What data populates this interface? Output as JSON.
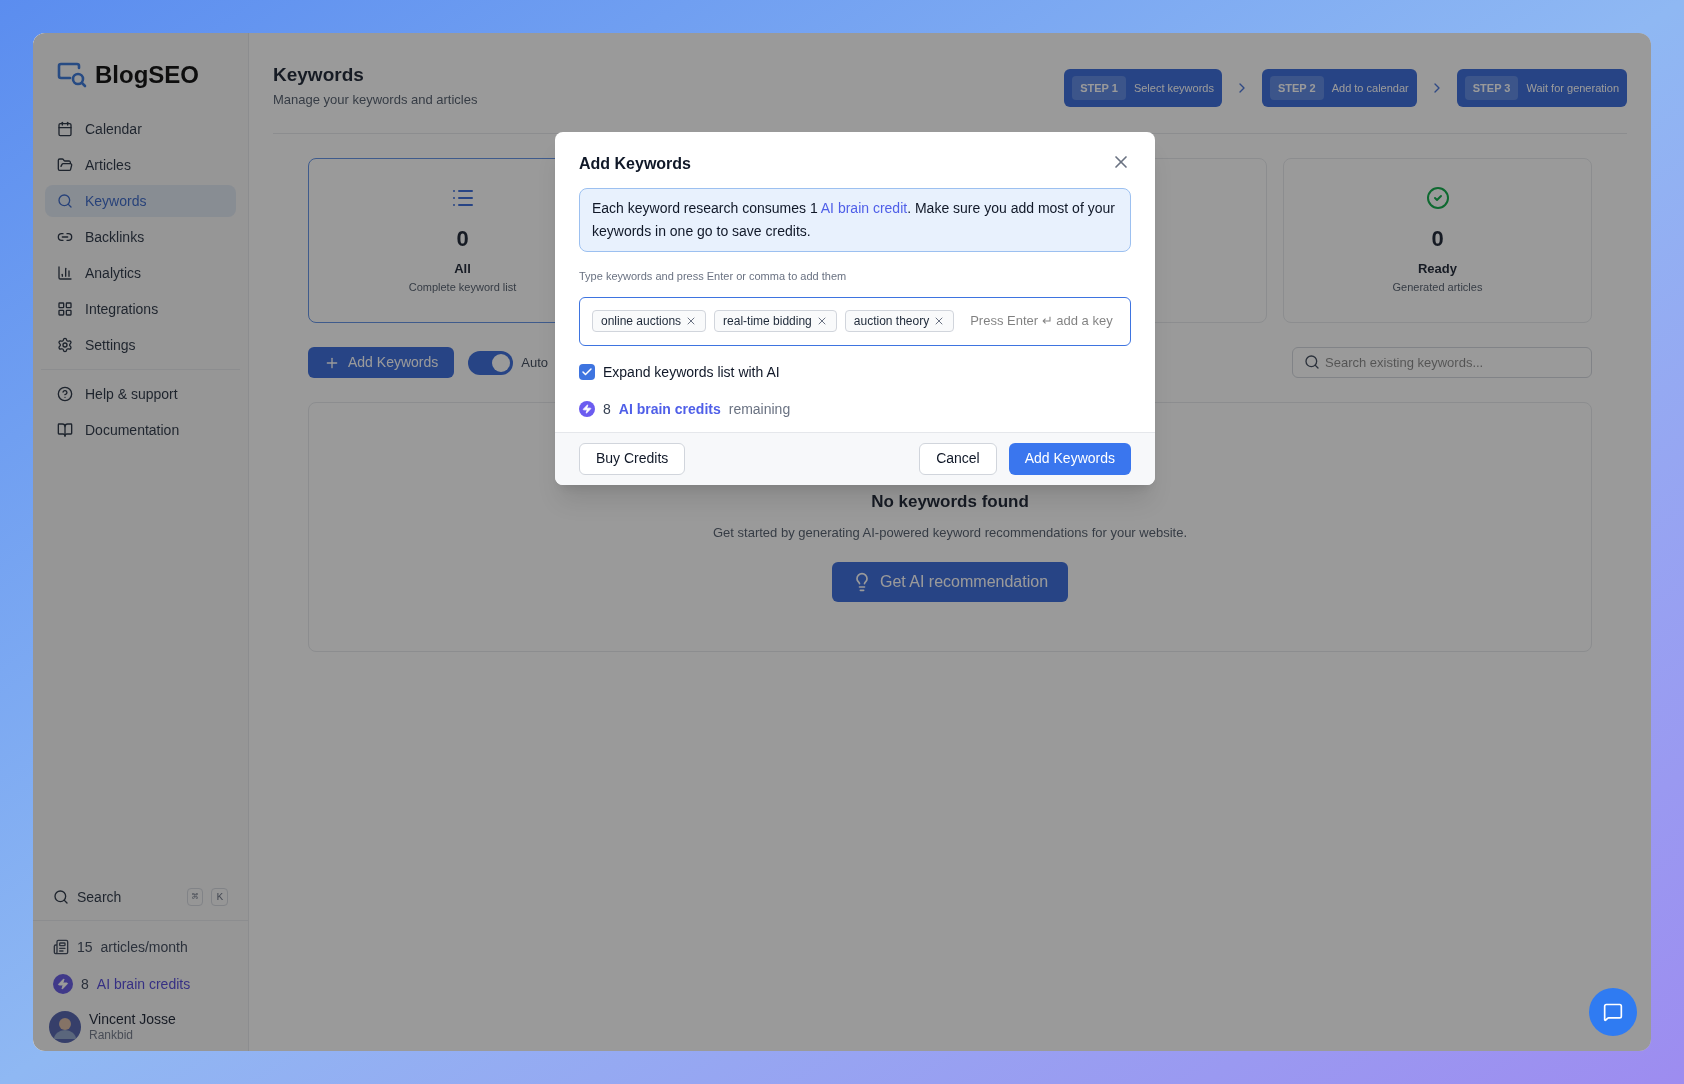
{
  "brand": "BlogSEO",
  "sidebar": {
    "items": [
      {
        "label": "Calendar",
        "selected": false
      },
      {
        "label": "Articles",
        "selected": false
      },
      {
        "label": "Keywords",
        "selected": true
      },
      {
        "label": "Backlinks",
        "selected": false
      },
      {
        "label": "Analytics",
        "selected": false
      },
      {
        "label": "Integrations",
        "selected": false
      },
      {
        "label": "Settings",
        "selected": false
      }
    ],
    "secondary_items": [
      {
        "label": "Help & support"
      },
      {
        "label": "Documentation"
      }
    ],
    "search": {
      "label": "Search",
      "keys": [
        "⌘",
        "K"
      ]
    },
    "articles": {
      "count": "15",
      "label": "articles/month"
    },
    "credits": {
      "count": "8",
      "label": "AI brain credits"
    },
    "user": {
      "name": "Vincent Josse",
      "company": "Rankbid"
    }
  },
  "header": {
    "title": "Keywords",
    "subtitle": "Manage your keywords and articles"
  },
  "steps": [
    {
      "step": "STEP 1",
      "label": "Select keywords"
    },
    {
      "step": "STEP 2",
      "label": "Add to calendar"
    },
    {
      "step": "STEP 3",
      "label": "Wait for generation"
    }
  ],
  "stat_cards": [
    {
      "value": "0",
      "title": "All",
      "caption": "Complete keyword list",
      "selected": true
    },
    {
      "value": "0",
      "title": "Ready",
      "caption": "Generated articles",
      "selected": false
    }
  ],
  "toolbar": {
    "add_button": "Add Keywords",
    "toggle": {
      "label": "Auto",
      "on": true
    },
    "search_placeholder": "Search existing keywords..."
  },
  "empty_state": {
    "title": "No keywords found",
    "text": "Get started by generating AI-powered keyword recommendations for your website.",
    "button": "Get AI recommendation"
  },
  "dialog": {
    "title": "Add Keywords",
    "notice": "Each keyword research consumes 1 **AI brain credit**. Make sure you add most of your keywords in one go to save credits.",
    "hint": "Type keywords and press Enter or comma to add them",
    "tags": [
      "online auctions",
      "real-time bidding",
      "auction theory"
    ],
    "placeholder": "Press Enter ↵ add a key",
    "expand": {
      "label": "Expand keywords list with AI",
      "checked": true
    },
    "credits": {
      "count": "8",
      "label": "AI brain credits",
      "suffix": "remaining"
    },
    "buttons": {
      "buy": "Buy Credits",
      "cancel": "Cancel",
      "add": "Add Keywords"
    }
  }
}
